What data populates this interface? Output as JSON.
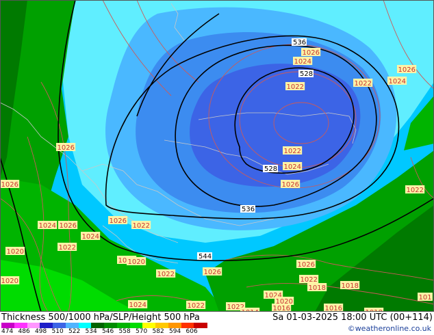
{
  "footer": {
    "title": "Thickness 500/1000 hPa/SLP/Height 500 hPa",
    "valid_time": "Sa 01-03-2025 18:00 UTC (00+114)",
    "credit": "©weatheronline.co.uk"
  },
  "legend": {
    "colors": [
      "#c800c8",
      "#ff32ff",
      "#ff96ff",
      "#1e1ec8",
      "#3c64e6",
      "#50b4ff",
      "#00ffff",
      "#006400",
      "#008c00",
      "#00b400",
      "#00dc00",
      "#ffff00",
      "#ffc800",
      "#ff9600",
      "#ff3200",
      "#c80000"
    ],
    "ticks": [
      "474",
      "486",
      "498",
      "510",
      "522",
      "534",
      "546",
      "558",
      "570",
      "582",
      "594",
      "606"
    ]
  },
  "map": {
    "thickness_labels": [
      "536",
      "528",
      "528",
      "536",
      "544"
    ],
    "slp_labels": [
      "1026",
      "1024",
      "1022",
      "1026",
      "1024",
      "1022",
      "1022",
      "1024",
      "1026",
      "1026",
      "1026",
      "1022",
      "1024",
      "1026",
      "1024",
      "1026",
      "1022",
      "1020",
      "1022",
      "1022",
      "1020",
      "1022",
      "1026",
      "1020",
      "1024",
      "1026",
      "1022",
      "1018",
      "1024",
      "1020",
      "1016",
      "1018",
      "1022",
      "1022",
      "1016",
      "1014",
      "1018",
      "101"
    ]
  }
}
